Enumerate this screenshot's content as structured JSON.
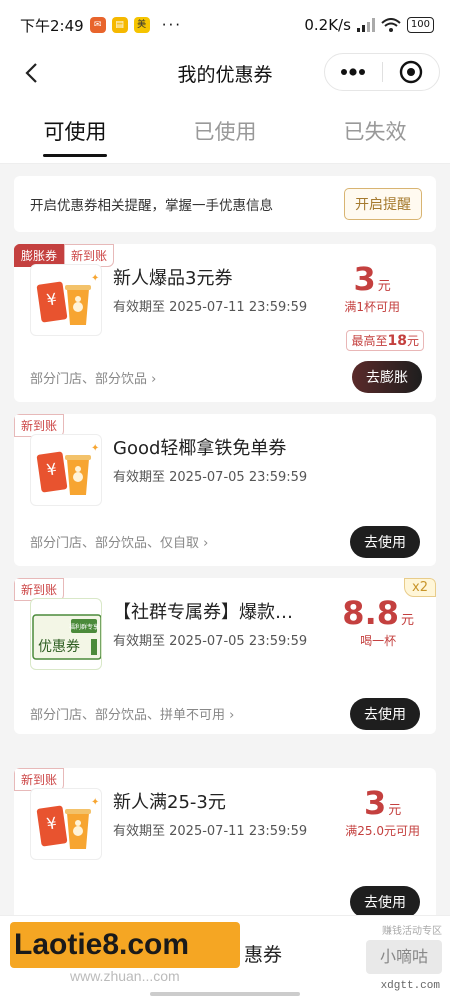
{
  "status_bar": {
    "time": "下午2:49",
    "speed": "0.2K/s",
    "battery": "100",
    "more": "···"
  },
  "nav": {
    "title": "我的优惠券"
  },
  "tabs": [
    {
      "label": "可使用",
      "active": true
    },
    {
      "label": "已使用",
      "active": false
    },
    {
      "label": "已失效",
      "active": false
    }
  ],
  "notice": {
    "text": "开启优惠券相关提醒，掌握一手优惠信息",
    "button": "开启提醒"
  },
  "coupons": [
    {
      "tags": [
        "膨胀券",
        "新到账"
      ],
      "name": "新人爆品3元券",
      "valid": "有效期至 2025-07-11 23:59:59",
      "amount": "3",
      "unit": "元",
      "condition": "满1杯可用",
      "max_label": "最高至",
      "max_value": "18",
      "max_unit": "元",
      "scope": "部分门店、部分饮品",
      "action": "去膨胀"
    },
    {
      "tags": [
        "新到账"
      ],
      "name": "Good轻椰拿铁免单券",
      "valid": "有效期至 2025-07-05 23:59:59",
      "scope": "部分门店、部分饮品、仅自取",
      "action": "去使用"
    },
    {
      "tags": [
        "新到账"
      ],
      "name": "【社群专属券】爆款…",
      "valid": "有效期至 2025-07-05 23:59:59",
      "amount": "8.8",
      "unit": "元",
      "condition": "喝一杯",
      "times": "x2",
      "thumb_label": "优惠券",
      "thumb_stamp": "福利群专享",
      "scope": "部分门店、部分饮品、拼单不可用",
      "action": "去使用"
    },
    {
      "tags": [
        "新到账"
      ],
      "name": "新人满25-3元",
      "valid": "有效期至 2025-07-11 23:59:59",
      "amount": "3",
      "unit": "元",
      "condition": "满25.0元可用",
      "action": "去使用"
    }
  ],
  "bottom": {
    "label": "惠券"
  },
  "watermark": {
    "logo_text": "Laotie8.com",
    "sub": "www.zhuan...com",
    "right": "小嘀咕",
    "small": "赚钱活动专区",
    "url": "xdgtt.com"
  },
  "colors": {
    "accent_red": "#c4403f",
    "gold": "#d8b472",
    "dark_button": "#1e1e1e"
  }
}
